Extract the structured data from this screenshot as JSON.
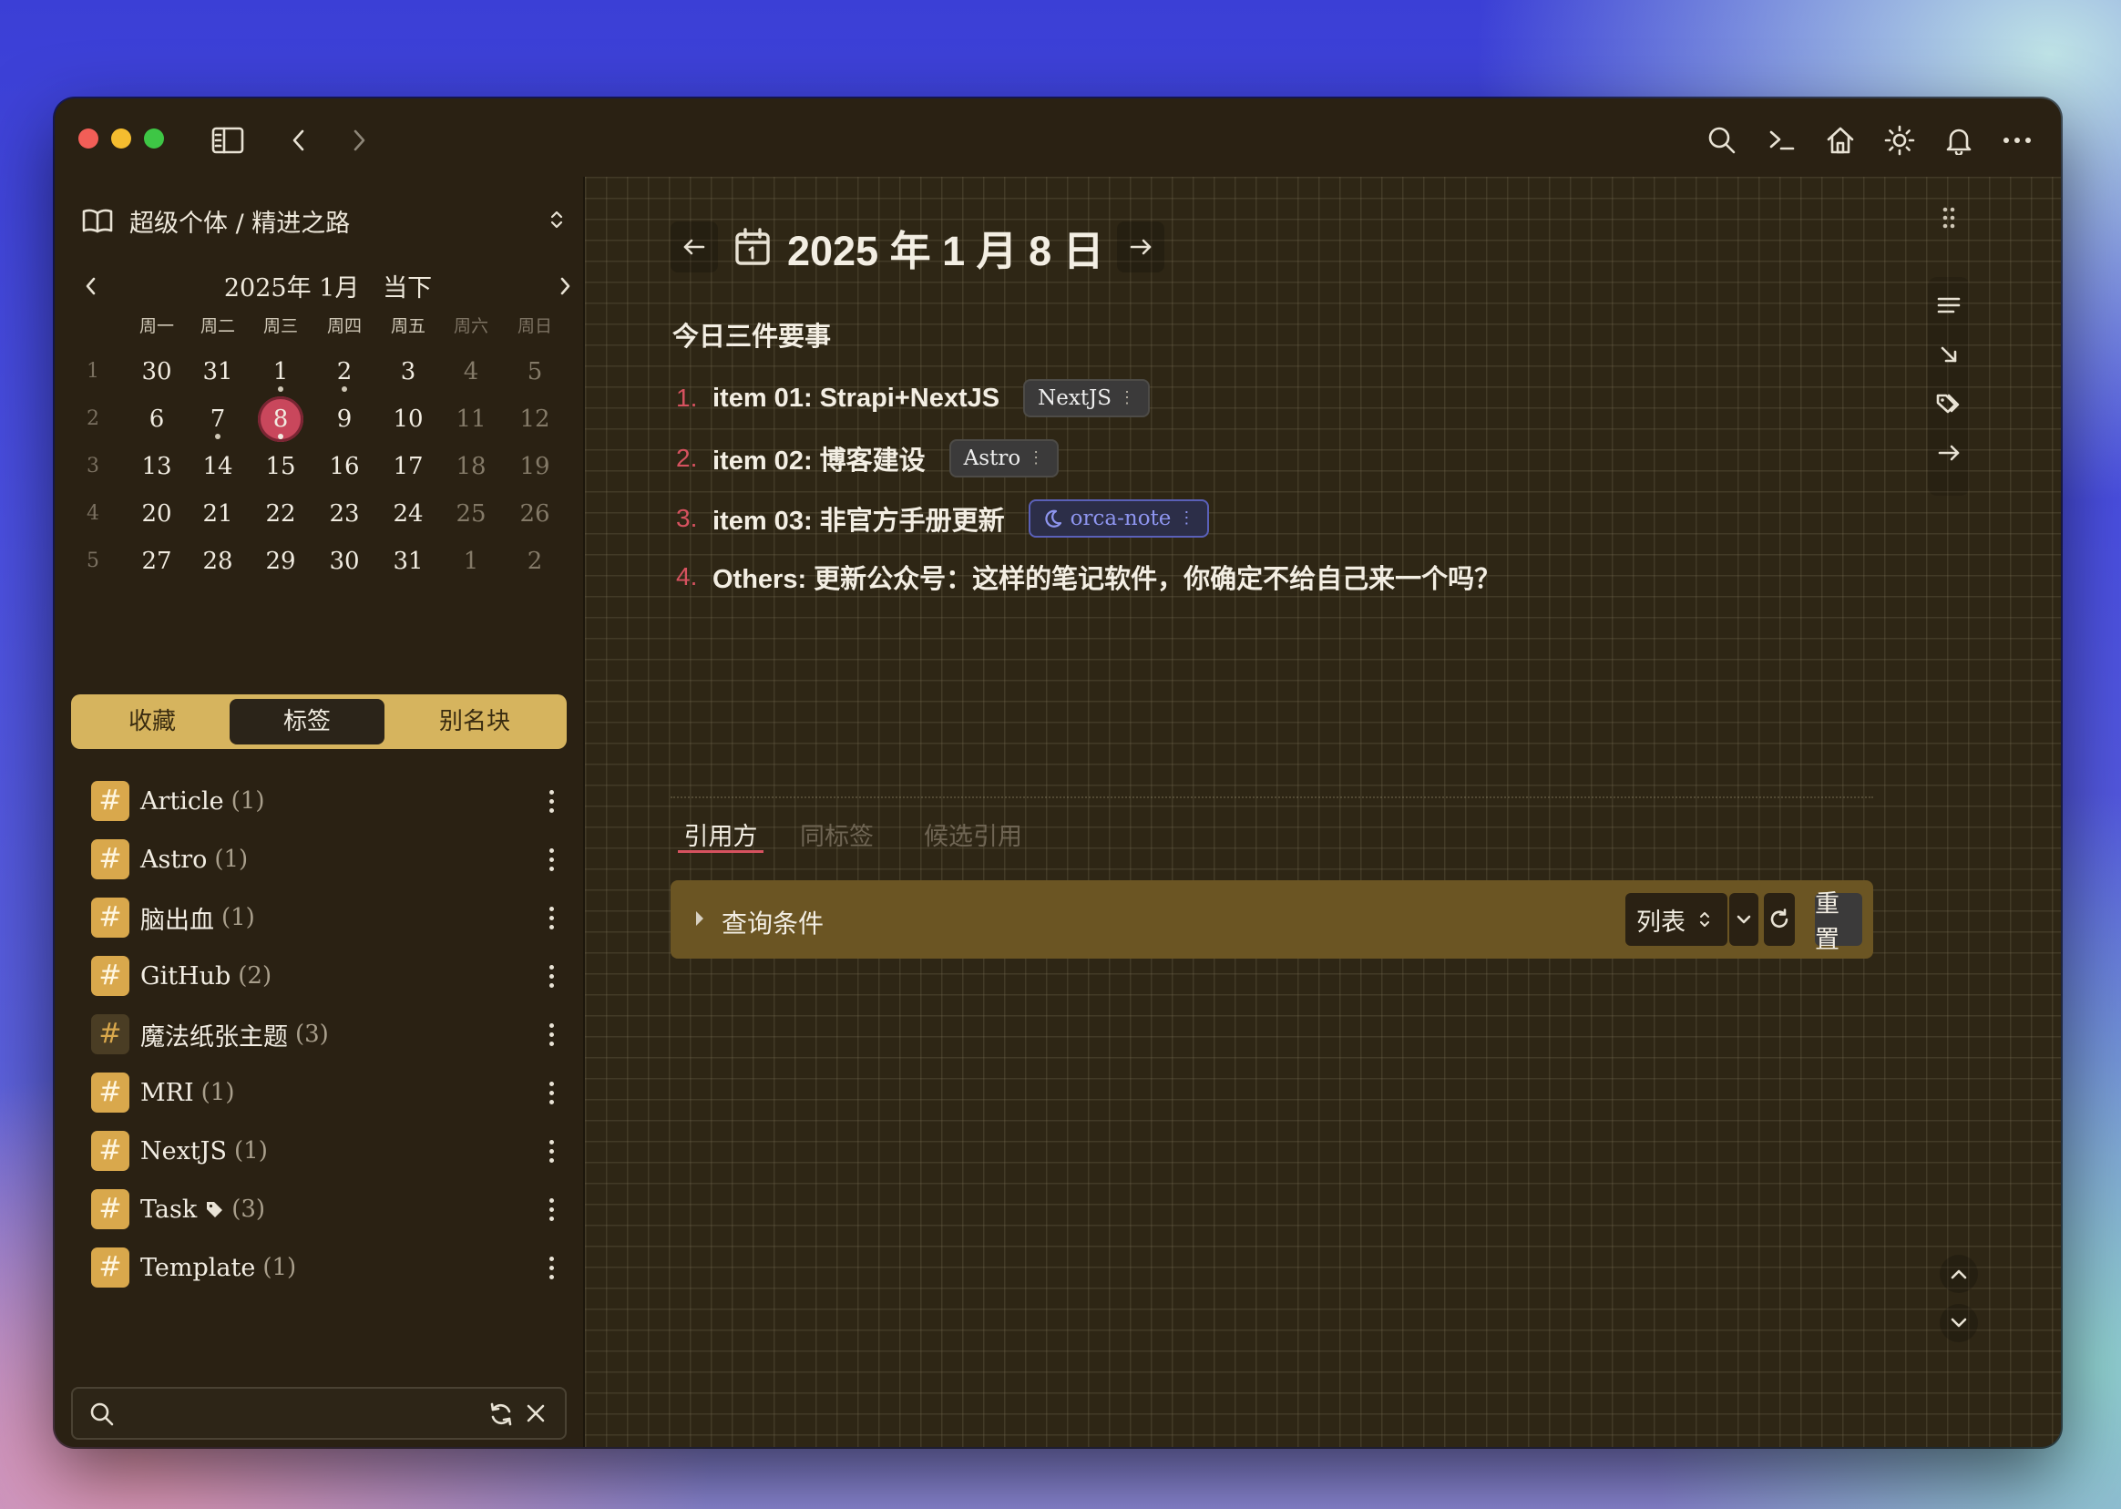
{
  "colors": {
    "accent": "#d6525f",
    "today": "#c9475c",
    "tag": "#d9a84c",
    "segment": "#d6b45e",
    "query_bar": "#6b5523",
    "background": "#2a2113"
  },
  "titlebar": {
    "icons": [
      "close-light",
      "minimize-light",
      "maximize-light",
      "sidebar-toggle-icon",
      "back-icon",
      "forward-icon",
      "search-icon",
      "terminal-icon",
      "home-icon",
      "sun-icon",
      "bell-icon",
      "more-icon"
    ]
  },
  "sidebar": {
    "workspace": "超级个体 / 精进之路",
    "calendar": {
      "title": "2025年 1月",
      "now_label": "当下",
      "weekdays": [
        "周一",
        "周二",
        "周三",
        "周四",
        "周五",
        "周六",
        "周日"
      ],
      "weeks": [
        {
          "no": "1",
          "days": [
            "30",
            "31",
            "1",
            "2",
            "3",
            "4",
            "5"
          ]
        },
        {
          "no": "2",
          "days": [
            "6",
            "7",
            "8",
            "9",
            "10",
            "11",
            "12"
          ]
        },
        {
          "no": "3",
          "days": [
            "13",
            "14",
            "15",
            "16",
            "17",
            "18",
            "19"
          ]
        },
        {
          "no": "4",
          "days": [
            "20",
            "21",
            "22",
            "23",
            "24",
            "25",
            "26"
          ]
        },
        {
          "no": "5",
          "days": [
            "27",
            "28",
            "29",
            "30",
            "31",
            "1",
            "2"
          ]
        }
      ],
      "today": "8"
    },
    "segments": [
      "收藏",
      "标签",
      "别名块"
    ],
    "active_segment": "标签",
    "tags": [
      {
        "name": "Article",
        "count": "(1)"
      },
      {
        "name": "Astro",
        "count": "(1)"
      },
      {
        "name": "脑出血",
        "count": "(1)"
      },
      {
        "name": "GitHub",
        "count": "(2)"
      },
      {
        "name": "魔法纸张主题",
        "count": "(3)"
      },
      {
        "name": "MRI",
        "count": "(1)"
      },
      {
        "name": "NextJS",
        "count": "(1)"
      },
      {
        "name": "Task",
        "count": "(3)"
      },
      {
        "name": "Template",
        "count": "(1)"
      }
    ],
    "search": {
      "placeholder": ""
    }
  },
  "main": {
    "date_title": "2025 年 1 月 8 日",
    "section_title": "今日三件要事",
    "items": [
      {
        "num": "1.",
        "text": "item 01: Strapi+NextJS",
        "tag": "NextJS"
      },
      {
        "num": "2.",
        "text": "item 02: 博客建设",
        "tag": "Astro"
      },
      {
        "num": "3.",
        "text": "item 03: 非官方手册更新",
        "tag": "orca-note"
      },
      {
        "num": "4.",
        "text": "Others: 更新公众号：这样的笔记软件，你确定不给自己来一个吗？",
        "tag": ""
      }
    ],
    "tabs": [
      "引用方",
      "同标签",
      "候选引用"
    ],
    "query": {
      "label": "查询条件",
      "view": "列表",
      "reset": "重置"
    }
  }
}
